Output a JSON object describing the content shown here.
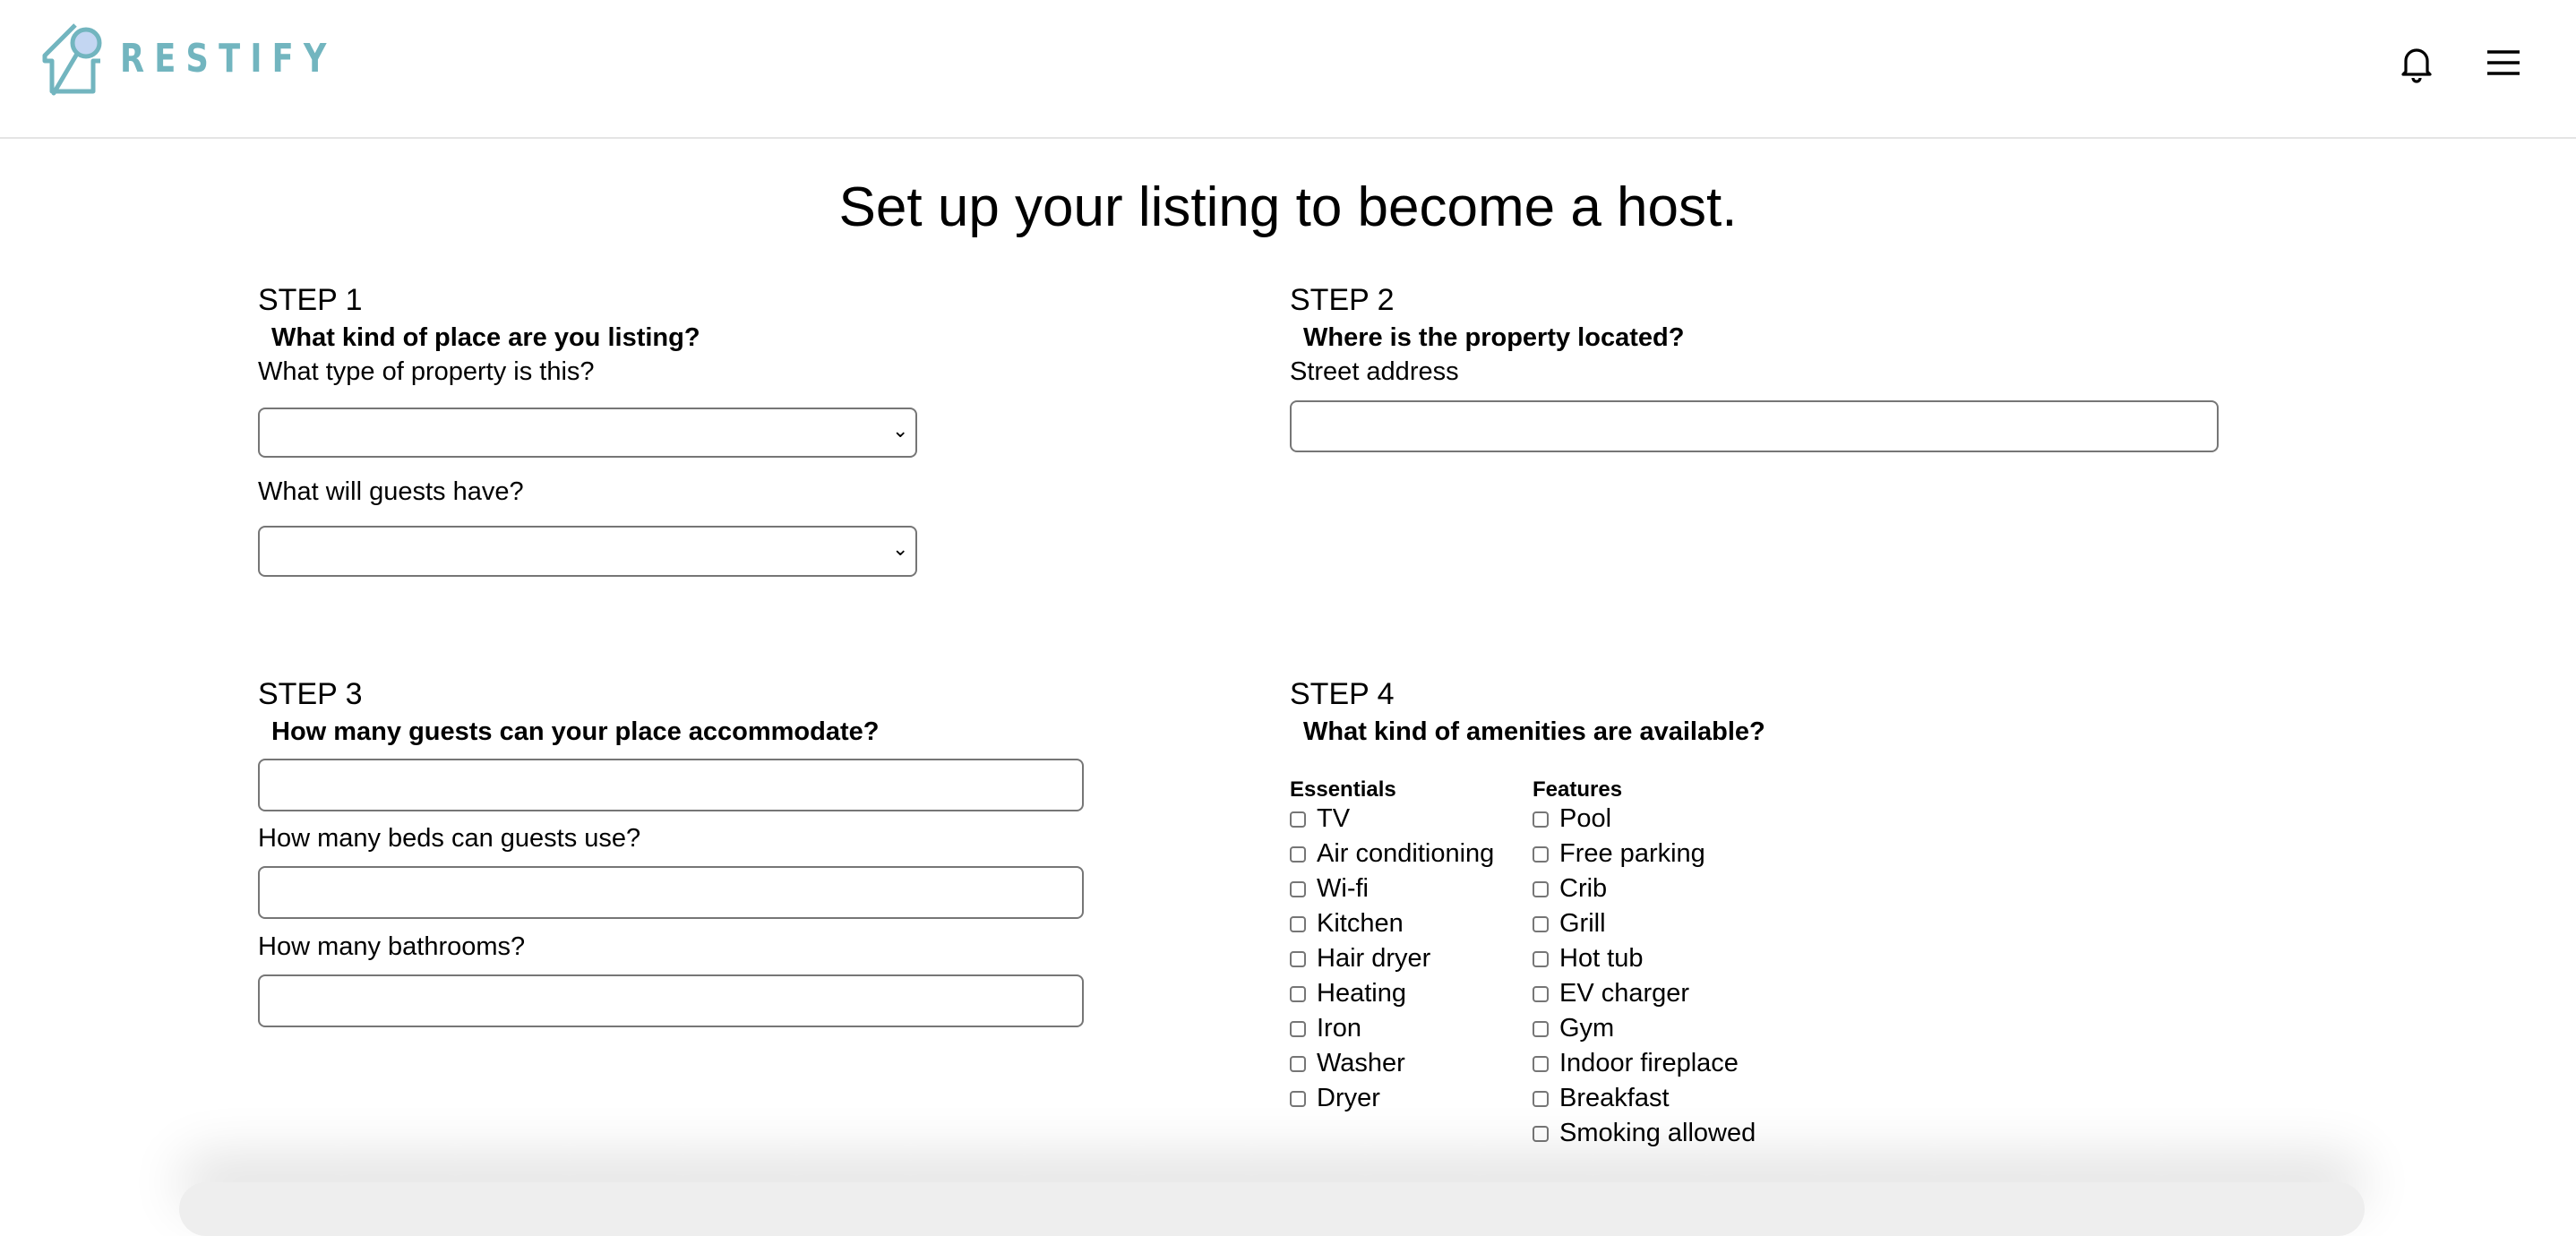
{
  "header": {
    "brand": "RESTIFY",
    "notifications_icon": "bell-icon",
    "menu_icon": "hamburger-icon"
  },
  "title": "Set up your listing to become a host.",
  "step1": {
    "step": "STEP 1",
    "heading": "What kind of place are you listing?",
    "property_type_label": "What type of property is this?",
    "property_type_value": "",
    "guests_have_label": "What will guests have?",
    "guests_have_value": ""
  },
  "step2": {
    "step": "STEP 2",
    "heading": "Where is the property located?",
    "address_label": "Street address",
    "address_value": ""
  },
  "step3": {
    "step": "STEP 3",
    "heading": "How many guests can your place accommodate?",
    "guests_value": "",
    "beds_label": "How many beds can guests use?",
    "beds_value": "",
    "bathrooms_label": "How many bathrooms?",
    "bathrooms_value": ""
  },
  "step4": {
    "step": "STEP 4",
    "heading": "What kind of amenities are available?",
    "essentials_label": "Essentials",
    "essentials": [
      "TV",
      "Air conditioning",
      "Wi-fi",
      "Kitchen",
      "Hair dryer",
      "Heating",
      "Iron",
      "Washer",
      "Dryer"
    ],
    "features_label": "Features",
    "features": [
      "Pool",
      "Free parking",
      "Crib",
      "Grill",
      "Hot tub",
      "EV charger",
      "Gym",
      "Indoor fireplace",
      "Breakfast",
      "Smoking allowed"
    ]
  }
}
